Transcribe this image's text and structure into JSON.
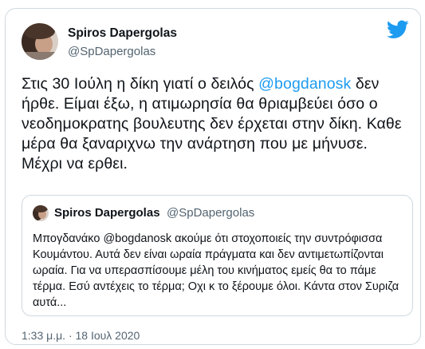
{
  "author": {
    "name": "Spiros Dapergolas",
    "handle": "@SpDapergolas",
    "avatar_icon": "profile-photo"
  },
  "tweet": {
    "text_before": "Στις 30 Ιούλη η δίκη γιατί ο δειλός ",
    "mention": "@bogdanosk",
    "text_after": " δεν ήρθε. Είμαι έξω, η ατιμωρησία θα θριαμβεύει όσο ο νεοδημοκρατης βουλευτης δεν έρχεται στην  δίκη. Καθε μέρα θα ξαναριχνω την ανάρτηση που με μήνυσε. Μέχρι να ερθει."
  },
  "quoted_tweet": {
    "name": "Spiros Dapergolas",
    "handle": "@SpDapergolas",
    "text": "Μπογδανάκο @bogdanosk ακούμε ότι στοχοποιείς την συντρόφισσα Κουμάντου. Αυτά δεν είναι ωραία πράγματα και δεν αντιμετωπίζονται ωραία. Για να υπερασπίσουμε μέλη του κινήματος εμείς θα το πάμε τέρμα. Εσύ αντέχεις το τέρμα; Οχι κ το ξέρουμε όλοι. Κάντα στον Συριζα αυτά..."
  },
  "timestamp": "1:33 μ.μ. · 18 Ιουλ 2020",
  "colors": {
    "link": "#1d9bf0",
    "secondary_text": "#536471",
    "border": "#cfd9de",
    "twitter_blue": "#1d9bf0"
  }
}
